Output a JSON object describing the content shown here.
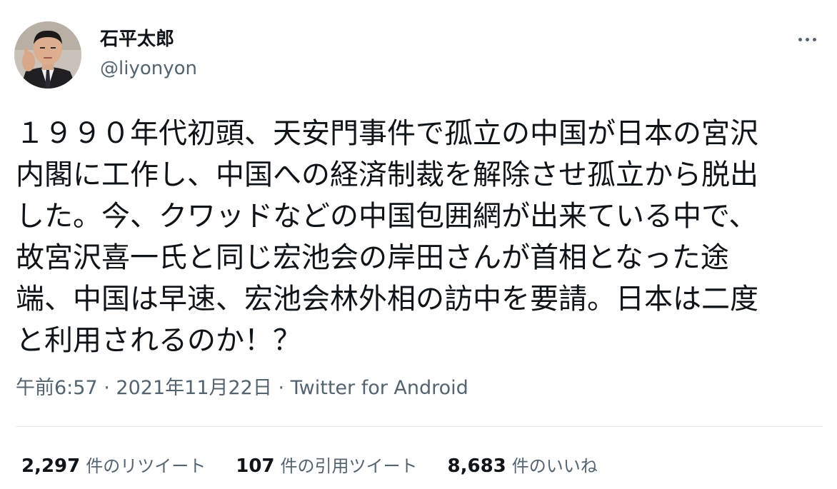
{
  "author": {
    "display_name": "石平太郎",
    "handle": "@liyonyon"
  },
  "tweet": {
    "lines": [
      "１９９０年代初頭、天安門事件で孤立の中国が日本の宮沢",
      "内閣に工作し、中国への経済制裁を解除させ孤立から脱出",
      "した。今、クワッドなどの中国包囲網が出来ている中で、",
      "故宮沢喜一氏と同じ宏池会の岸田さんが首相となった途",
      "端、中国は早速、宏池会林外相の訪中を要請。日本は二度",
      "と利用されるのか！？"
    ]
  },
  "meta": {
    "time": "午前6:57",
    "separator": "·",
    "date": "2021年11月22日",
    "source": "Twitter for Android"
  },
  "stats": {
    "retweets": {
      "count": "2,297",
      "label": "件のリツイート"
    },
    "quotes": {
      "count": "107",
      "label": "件の引用ツイート"
    },
    "likes": {
      "count": "8,683",
      "label": "件のいいね"
    }
  },
  "icons": {
    "more": "more-horizontal-icon"
  },
  "colors": {
    "primary_text": "#0f1419",
    "secondary_text": "#536471",
    "divider": "#e6ecf0"
  }
}
